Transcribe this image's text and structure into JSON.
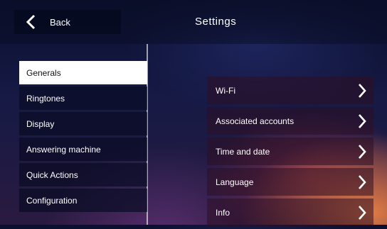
{
  "header": {
    "back_label": "Back",
    "title": "Settings"
  },
  "menu": {
    "items": [
      {
        "label": "Generals",
        "selected": true
      },
      {
        "label": "Ringtones",
        "selected": false
      },
      {
        "label": "Display",
        "selected": false
      },
      {
        "label": "Answering machine",
        "selected": false
      },
      {
        "label": "Quick Actions",
        "selected": false
      },
      {
        "label": "Configuration",
        "selected": false
      }
    ]
  },
  "generals": {
    "rows": [
      {
        "label": "Wi-Fi"
      },
      {
        "label": "Associated accounts"
      },
      {
        "label": "Time and date"
      },
      {
        "label": "Language"
      },
      {
        "label": "Info"
      }
    ]
  },
  "icons": {
    "back": "chevron-left-icon",
    "row_arrow": "chevron-right-icon"
  },
  "colors": {
    "selected_bg": "#ffffff",
    "selected_text": "#111111",
    "text": "#ffffff"
  }
}
